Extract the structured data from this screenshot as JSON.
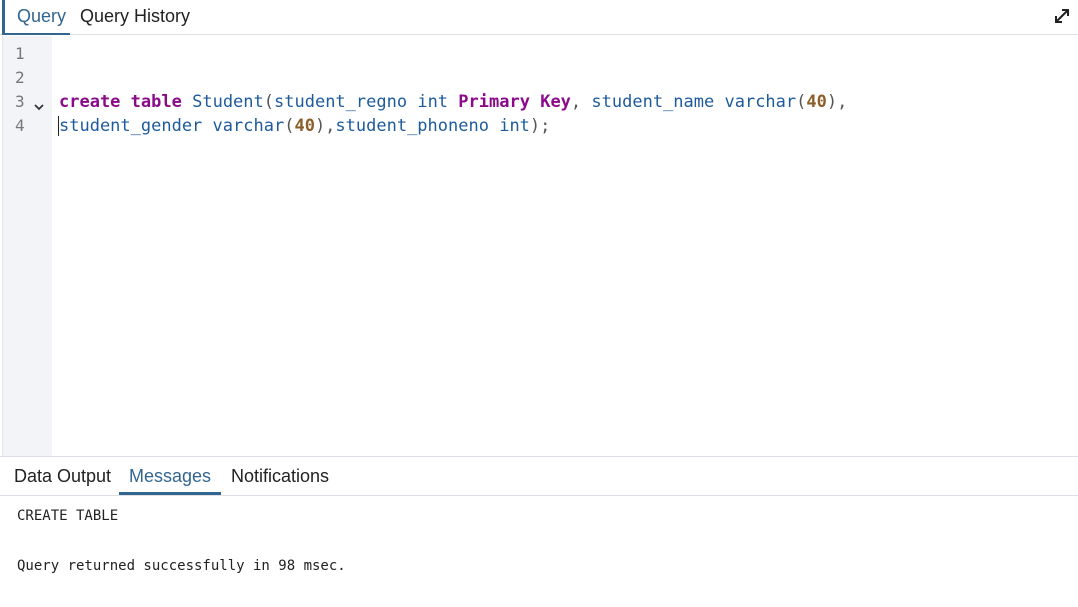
{
  "query_tabs": {
    "query_label": "Query",
    "history_label": "Query History"
  },
  "icons": {
    "expand": "expand-arrows-icon",
    "fold": "chevron-down-icon"
  },
  "editor": {
    "line_numbers": [
      "1",
      "2",
      "3",
      "4"
    ],
    "line3": {
      "t1": "create",
      "t2": " ",
      "t3": "table",
      "t4": " ",
      "t5": "Student",
      "t6": "(",
      "t7": "student_regno",
      "t8": " ",
      "t9": "int",
      "t10": " ",
      "t11": "Primary",
      "t12": " ",
      "t13": "Key",
      "t14": ", ",
      "t15": "student_name",
      "t16": " ",
      "t17": "varchar",
      "t18": "(",
      "t19": "40",
      "t20": "),"
    },
    "line4": {
      "t1": "student_gender",
      "t2": " ",
      "t3": "varchar",
      "t4": "(",
      "t5": "40",
      "t6": "),",
      "t7": "student_phoneno",
      "t8": " ",
      "t9": "int",
      "t10": ");"
    }
  },
  "result_tabs": {
    "data_output": "Data Output",
    "messages": "Messages",
    "notifications": "Notifications"
  },
  "messages": {
    "line1": "CREATE TABLE",
    "line2": "Query returned successfully in 98 msec."
  },
  "colors": {
    "accent": "#326690",
    "keyword": "#8b0a8a",
    "identifier": "#1d5b9c",
    "number": "#8d5f2a"
  }
}
